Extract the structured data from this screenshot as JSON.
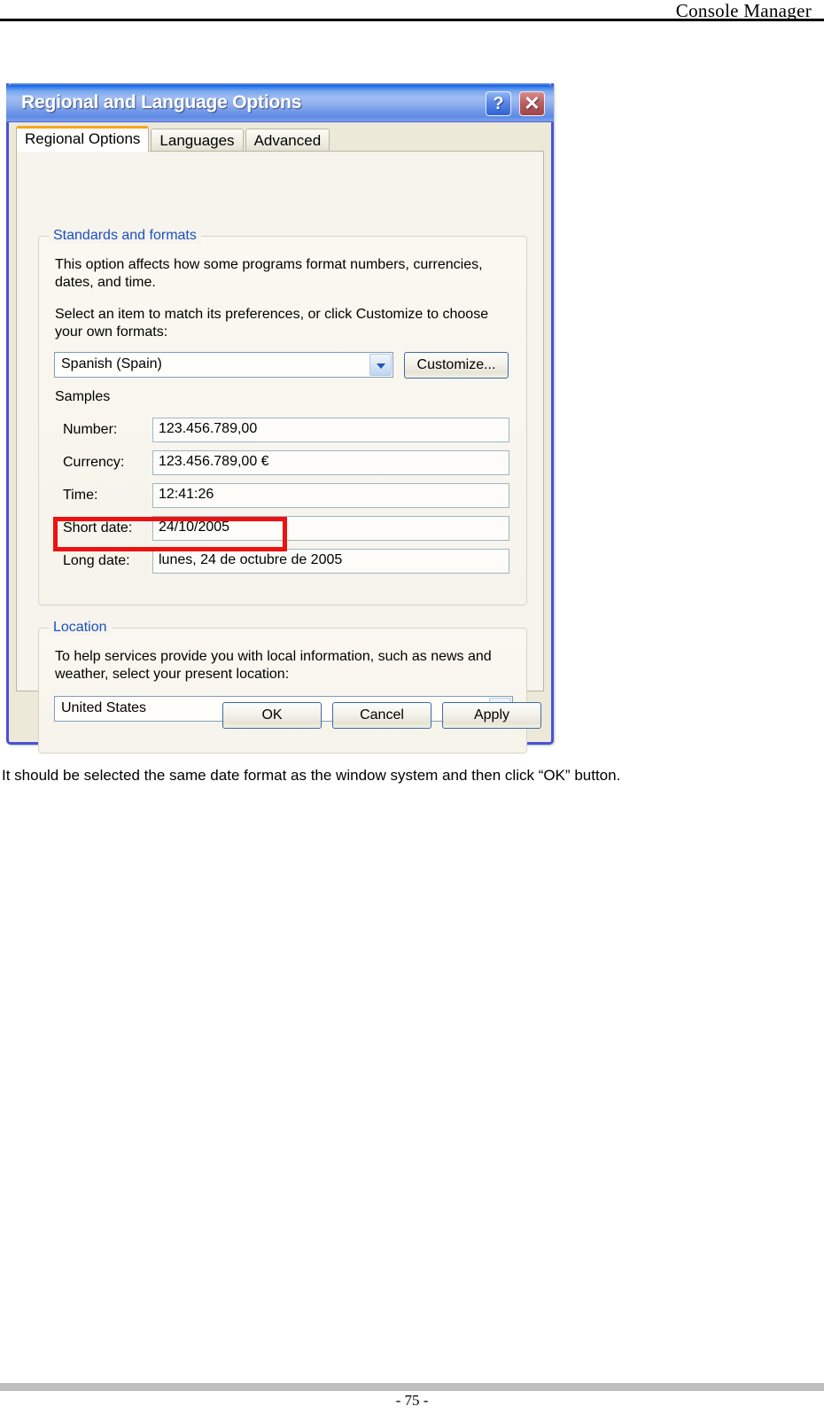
{
  "page": {
    "header_title": "Console Manager",
    "page_number": "- 75 -",
    "caption": "It should be selected the same date format as the window system and then click “OK” button."
  },
  "dialog": {
    "title": "Regional and Language Options",
    "help_button": "?",
    "close_button": "✕",
    "tabs": [
      {
        "label": "Regional Options",
        "active": true
      },
      {
        "label": "Languages",
        "active": false
      },
      {
        "label": "Advanced",
        "active": false
      }
    ],
    "standards_group": {
      "title": "Standards and formats",
      "description_1": "This option affects how some programs format numbers, currencies, dates, and time.",
      "description_2": "Select an item to match its preferences, or click Customize to choose your own formats:",
      "locale_value": "Spanish (Spain)",
      "customize_button": "Customize...",
      "samples_title": "Samples",
      "samples": [
        {
          "label": "Number:",
          "value": "123.456.789,00"
        },
        {
          "label": "Currency:",
          "value": "123.456.789,00 €"
        },
        {
          "label": "Time:",
          "value": "12:41:26"
        },
        {
          "label": "Short date:",
          "value": "24/10/2005"
        },
        {
          "label": "Long date:",
          "value": "lunes, 24 de octubre de 2005"
        }
      ]
    },
    "location_group": {
      "title": "Location",
      "description": "To help services provide you with local information, such as news and weather, select your present location:",
      "location_value": "United States"
    },
    "buttons": {
      "ok": "OK",
      "cancel": "Cancel",
      "apply": "Apply"
    }
  },
  "annotation": {
    "highlight_color": "#ee1111",
    "highlight_target": "Short date: 24/10/2005"
  },
  "colors": {
    "titlebar_blue": "#4a51d8",
    "dialog_face": "#ece9d8",
    "group_label_blue": "#1a4fc4",
    "active_tab_accent": "#f5a623",
    "footer_gray": "#bfbfbf"
  }
}
